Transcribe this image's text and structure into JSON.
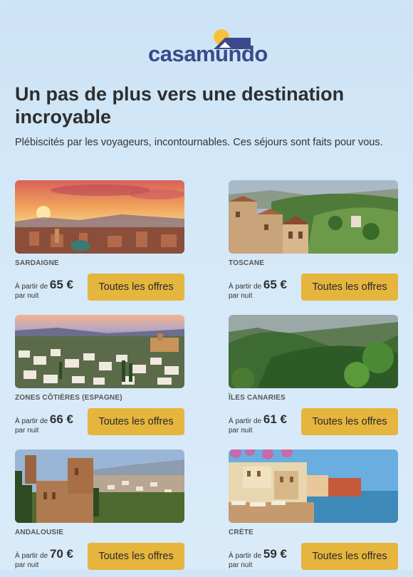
{
  "brand": {
    "name": "casamundo",
    "sun_color": "#f7c13a",
    "roof_color": "#3a4a8a"
  },
  "headline": "Un pas de plus vers une destination incroyable",
  "subtitle": "Plébiscités par les voyageurs, incontournables. Ces séjours sont faits pour vous.",
  "offers": [
    {
      "destination": "SARDAIGNE",
      "from_label": "À partir de",
      "price": "65 €",
      "per": "par nuit",
      "button": "Toutes les offres",
      "image": "sunset-city-photo"
    },
    {
      "destination": "TOSCANE",
      "from_label": "À partir de",
      "price": "65 €",
      "per": "par nuit",
      "button": "Toutes les offres",
      "image": "tuscan-village-photo"
    },
    {
      "destination": "ZONES CÔTIÈRES (ESPAGNE)",
      "from_label": "À partir de",
      "price": "66 €",
      "per": "par nuit",
      "button": "Toutes les offres",
      "image": "white-village-photo"
    },
    {
      "destination": "ÎLES CANARIES",
      "from_label": "À partir de",
      "price": "61 €",
      "per": "par nuit",
      "button": "Toutes les offres",
      "image": "green-mountains-photo"
    },
    {
      "destination": "ANDALOUSIE",
      "from_label": "À partir de",
      "price": "70 €",
      "per": "par nuit",
      "button": "Toutes les offres",
      "image": "alhambra-photo"
    },
    {
      "destination": "CRÈTE",
      "from_label": "À partir de",
      "price": "59 €",
      "per": "par nuit",
      "button": "Toutes les offres",
      "image": "harbor-photo"
    }
  ]
}
